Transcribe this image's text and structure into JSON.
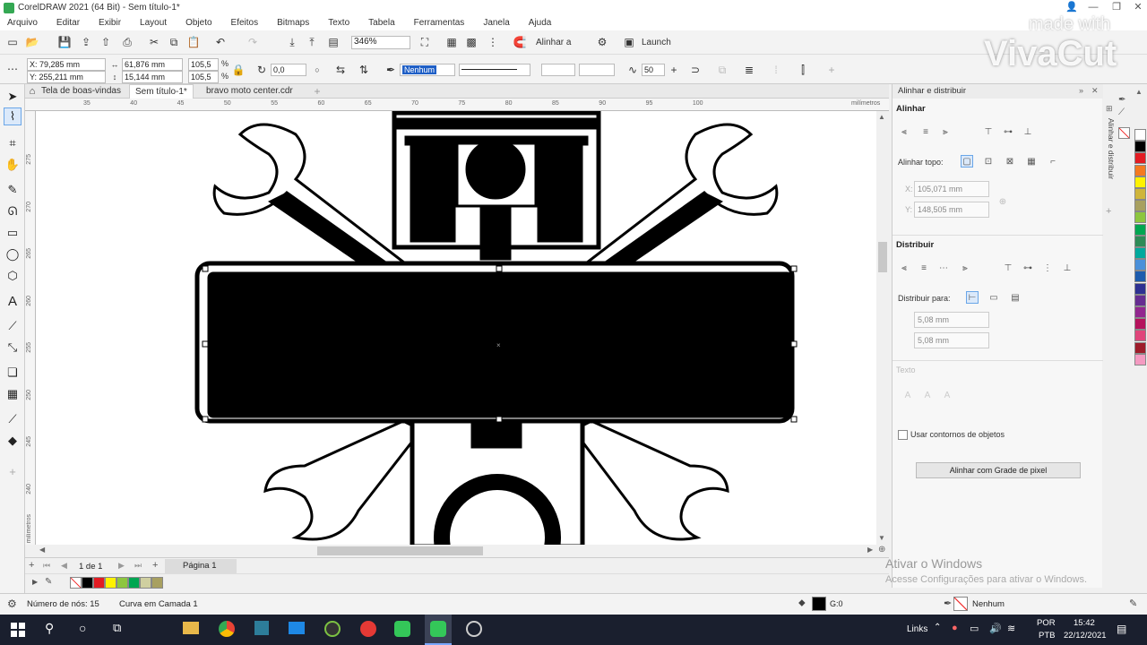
{
  "window": {
    "title": "CorelDRAW 2021 (64 Bit) - Sem título-1*"
  },
  "menu": [
    "Arquivo",
    "Editar",
    "Exibir",
    "Layout",
    "Objeto",
    "Efeitos",
    "Bitmaps",
    "Texto",
    "Tabela",
    "Ferramentas",
    "Janela",
    "Ajuda"
  ],
  "toolbar1": {
    "zoom": "346%",
    "align_label": "Alinhar a",
    "launch_label": "Launch"
  },
  "property_bar": {
    "x": "X: 79,285 mm",
    "y": "Y: 255,211 mm",
    "w": "61,876 mm",
    "h": "15,144 mm",
    "scale_w": "105,5",
    "scale_h": "105,5",
    "percent": "%",
    "rotation": "0,0",
    "outline": "Nenhum",
    "nodes_value": "50"
  },
  "doc_tabs": [
    "Tela de boas-vindas",
    "Sem título-1*",
    "bravo moto center.cdr"
  ],
  "ruler": {
    "h_ticks": [
      "35",
      "40",
      "45",
      "50",
      "55",
      "60",
      "65",
      "70",
      "75",
      "80",
      "85",
      "90",
      "95",
      "100"
    ],
    "unit": "milímetros",
    "v_ticks": [
      "275",
      "270",
      "265",
      "260",
      "255",
      "250",
      "245",
      "240"
    ]
  },
  "page_nav": {
    "page_count": "1 de 1",
    "page_tab": "Página 1"
  },
  "status": {
    "nodes": "Número de nós: 15",
    "object": "Curva em Camada 1",
    "fill_label": "G:0",
    "outline_label": "Nenhum"
  },
  "docker": {
    "header": "Alinhar e distribuir",
    "align_title": "Alinhar",
    "align_top_label": "Alinhar topo:",
    "x_field": "105,071 mm",
    "y_field": "148,505 mm",
    "distribute_title": "Distribuir",
    "distribute_to_label": "Distribuir para:",
    "spacing_h": "5,08 mm",
    "spacing_v": "5,08 mm",
    "text_title": "Texto",
    "use_outlines_label": "Usar contornos de objetos",
    "pixel_grid_button": "Alinhar com Grade de pixel",
    "side_tab": "Alinhar e distribuir"
  },
  "palette_colors": [
    "#ffffff",
    "#000000",
    "#e31c23",
    "#f47a20",
    "#fff200",
    "#cfb53b",
    "#a8a060",
    "#8dc63f",
    "#00a651",
    "#2e8b57",
    "#00a99d",
    "#4a90d9",
    "#1d5cae",
    "#2e3192",
    "#662d91",
    "#92278f",
    "#b5125c",
    "#e0457b",
    "#9e1c2a",
    "#f49ac1"
  ],
  "mini_palette": [
    "#000000",
    "#e31c23",
    "#fff200",
    "#8dc63f",
    "#00a651",
    "#cfcfa0",
    "#a8a060"
  ],
  "watermark": {
    "line1": "made with",
    "line2": "VivaCut"
  },
  "activation": {
    "line1": "Ativar o Windows",
    "line2": "Acesse Configurações para ativar o Windows."
  },
  "taskbar": {
    "links": "Links",
    "lang1": "POR",
    "lang2": "PTB",
    "time": "15:42",
    "date": "22/12/2021"
  }
}
